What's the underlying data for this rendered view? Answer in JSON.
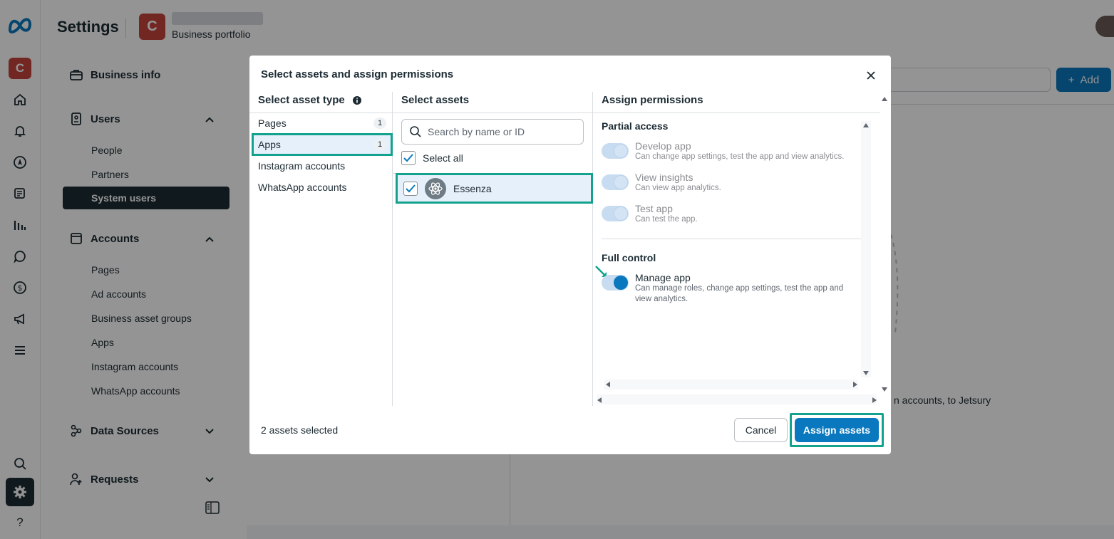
{
  "header": {
    "title": "Settings",
    "business_initial": "C",
    "business_label": "Business portfolio"
  },
  "rail": {
    "avatar_initial": "C",
    "help_label": "?"
  },
  "sidebar": {
    "business_info": "Business info",
    "users": {
      "label": "Users",
      "items": [
        "People",
        "Partners",
        "System users"
      ]
    },
    "accounts": {
      "label": "Accounts",
      "items": [
        "Pages",
        "Ad accounts",
        "Business asset groups",
        "Apps",
        "Instagram accounts",
        "WhatsApp accounts"
      ]
    },
    "data_sources": "Data Sources",
    "requests": "Requests"
  },
  "main": {
    "add_label": "Add",
    "description_fragment": "n accounts, to Jetsury"
  },
  "modal": {
    "title": "Select assets and assign permissions",
    "col1_header": "Select asset type",
    "col2_header": "Select assets",
    "col3_header": "Assign permissions",
    "asset_types": [
      {
        "label": "Pages",
        "count": "1"
      },
      {
        "label": "Apps",
        "count": "1"
      },
      {
        "label": "Instagram accounts",
        "count": ""
      },
      {
        "label": "WhatsApp accounts",
        "count": ""
      }
    ],
    "search_placeholder": "Search by name or ID",
    "select_all": "Select all",
    "asset_name": "Essenza",
    "partial_access": "Partial access",
    "full_control": "Full control",
    "permissions": [
      {
        "title": "Develop app",
        "desc": "Can change app settings, test the app and view analytics.",
        "on": false
      },
      {
        "title": "View insights",
        "desc": "Can view app analytics.",
        "on": false
      },
      {
        "title": "Test app",
        "desc": "Can test the app.",
        "on": false
      },
      {
        "title": "Manage app",
        "desc": "Can manage roles, change app settings, test the app and view analytics.",
        "on": true
      }
    ],
    "footer_count": "2 assets selected",
    "cancel_label": "Cancel",
    "assign_label": "Assign assets"
  },
  "colors": {
    "accent": "#0a78be",
    "highlight": "#12a28e",
    "brand_red": "#c5443c"
  }
}
